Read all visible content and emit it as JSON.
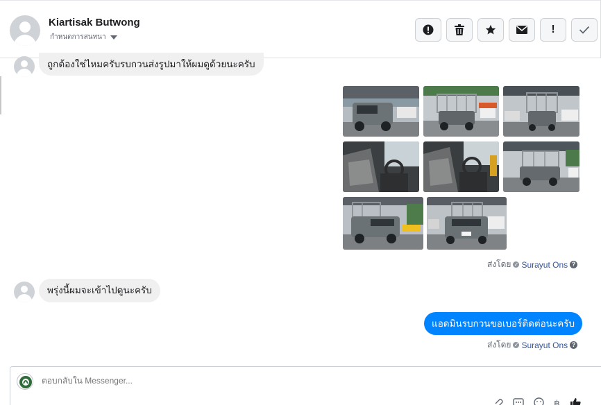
{
  "header": {
    "contact_name": "Kiartisak Butwong",
    "status_label": "กำหนดการสนทนา",
    "toolbar": [
      {
        "icon": "alert-circle-icon",
        "label": "!"
      },
      {
        "icon": "trash-icon",
        "label": ""
      },
      {
        "icon": "star-icon",
        "label": "★"
      },
      {
        "icon": "envelope-icon",
        "label": ""
      },
      {
        "icon": "exclamation-icon",
        "label": "!"
      },
      {
        "icon": "checkmark-icon",
        "label": "✓"
      }
    ]
  },
  "conversation": {
    "incoming_1": "ถูกต้องใช่ไหมครับรบกวนส่งรูปมาให้ผมดูด้วยนะครับ",
    "photos_sent_by_label": "ส่งโดย",
    "photos_sent_by_name": "Surayut Ons",
    "incoming_2": "พรุ่งนี้ผมจะเข้าไปดูนะครับ",
    "outgoing_1": "แอดมินรบกวนขอเบอร์ติดต่อนะครับ",
    "reply_sent_by_label": "ส่งโดย",
    "reply_sent_by_name": "Surayut Ons",
    "photo_count": 8
  },
  "composer": {
    "placeholder": "ตอบกลับใน Messenger..."
  },
  "colors": {
    "accent": "#0084ff",
    "incoming_bubble": "#f1f0f0",
    "link": "#365899"
  }
}
